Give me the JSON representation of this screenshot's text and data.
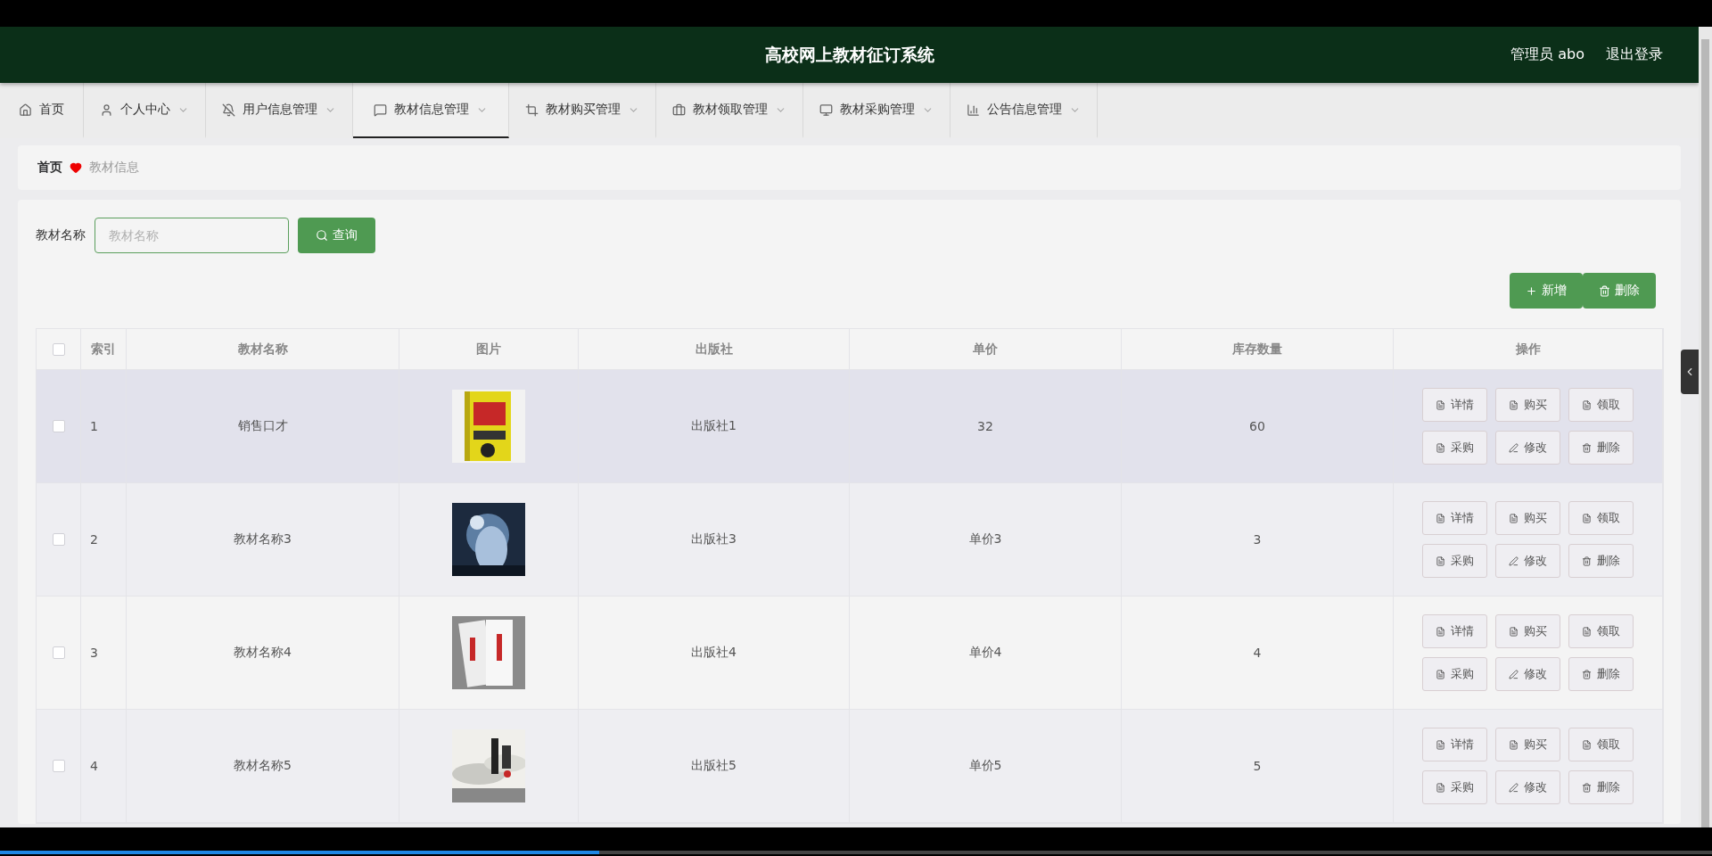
{
  "header": {
    "title": "高校网上教材征订系统",
    "user": "管理员 abo",
    "logout": "退出登录"
  },
  "nav": [
    {
      "label": "首页",
      "kind": "home",
      "selected": false,
      "dropdown": false
    },
    {
      "label": "个人中心",
      "kind": "user",
      "selected": false,
      "dropdown": true
    },
    {
      "label": "用户信息管理",
      "kind": "bell",
      "selected": false,
      "dropdown": true
    },
    {
      "label": "教材信息管理",
      "kind": "message",
      "selected": true,
      "dropdown": true
    },
    {
      "label": "教材购买管理",
      "kind": "crop",
      "selected": false,
      "dropdown": true
    },
    {
      "label": "教材领取管理",
      "kind": "briefcase",
      "selected": false,
      "dropdown": true
    },
    {
      "label": "教材采购管理",
      "kind": "monitor",
      "selected": false,
      "dropdown": true
    },
    {
      "label": "公告信息管理",
      "kind": "chart",
      "selected": false,
      "dropdown": true
    }
  ],
  "breadcrumb": {
    "home": "首页",
    "current": "教材信息"
  },
  "search": {
    "label": "教材名称",
    "placeholder": "教材名称",
    "button": "查询"
  },
  "toolbar": [
    {
      "label": "新增",
      "kind": "add"
    },
    {
      "label": "删除",
      "kind": "delete"
    }
  ],
  "table": {
    "select_all": {
      "checked": false
    },
    "columns": [
      "索引",
      "教材名称",
      "图片",
      "出版社",
      "单价",
      "库存数量",
      "操作"
    ],
    "rows": [
      {
        "checked": false,
        "hovered": true,
        "cells": [
          "1",
          "销售口才"
        ],
        "image": {
          "kind": "picture"
        },
        "cells_after": [
          "出版社1",
          "32",
          "60"
        ],
        "actions": [
          {
            "label": "详情",
            "kind": "doc"
          },
          {
            "label": "购买",
            "kind": "doc"
          },
          {
            "label": "领取",
            "kind": "doc"
          },
          {
            "label": "采购",
            "kind": "doc"
          },
          {
            "label": "修改",
            "kind": "edit"
          },
          {
            "label": "删除",
            "kind": "delete"
          }
        ]
      },
      {
        "checked": false,
        "hovered": false,
        "cells": [
          "2",
          "教材名称3"
        ],
        "image": {
          "kind": "picture"
        },
        "cells_after": [
          "出版社3",
          "单价3",
          "3"
        ],
        "actions": [
          {
            "label": "详情",
            "kind": "doc"
          },
          {
            "label": "购买",
            "kind": "doc"
          },
          {
            "label": "领取",
            "kind": "doc"
          },
          {
            "label": "采购",
            "kind": "doc"
          },
          {
            "label": "修改",
            "kind": "edit"
          },
          {
            "label": "删除",
            "kind": "delete"
          }
        ]
      },
      {
        "checked": false,
        "hovered": false,
        "cells": [
          "3",
          "教材名称4"
        ],
        "image": {
          "kind": "picture"
        },
        "cells_after": [
          "出版社4",
          "单价4",
          "4"
        ],
        "actions": [
          {
            "label": "详情",
            "kind": "doc"
          },
          {
            "label": "购买",
            "kind": "doc"
          },
          {
            "label": "领取",
            "kind": "doc"
          },
          {
            "label": "采购",
            "kind": "doc"
          },
          {
            "label": "修改",
            "kind": "edit"
          },
          {
            "label": "删除",
            "kind": "delete"
          }
        ]
      },
      {
        "checked": false,
        "hovered": false,
        "cells": [
          "4",
          "教材名称5"
        ],
        "image": {
          "kind": "picture"
        },
        "cells_after": [
          "出版社5",
          "单价5",
          "5"
        ],
        "actions": [
          {
            "label": "详情",
            "kind": "doc"
          },
          {
            "label": "购买",
            "kind": "doc"
          },
          {
            "label": "领取",
            "kind": "doc"
          },
          {
            "label": "采购",
            "kind": "doc"
          },
          {
            "label": "修改",
            "kind": "edit"
          },
          {
            "label": "删除",
            "kind": "delete"
          }
        ]
      }
    ]
  },
  "video_progress": {
    "level": 0.35
  }
}
